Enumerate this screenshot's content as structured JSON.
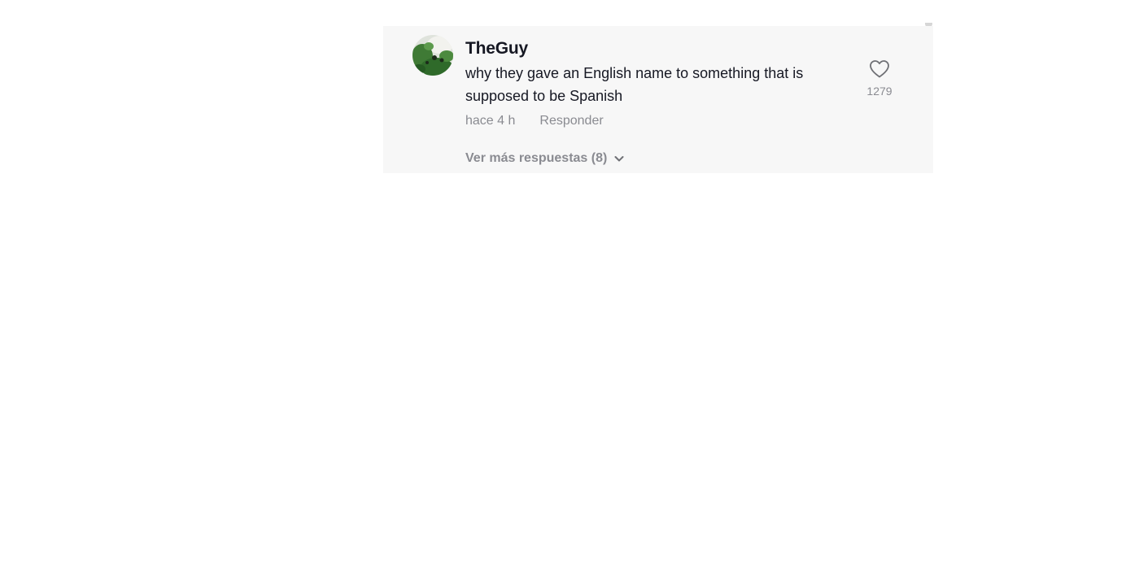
{
  "comment": {
    "username": "TheGuy",
    "text": "why they gave an English name to something that is supposed to be Spanish",
    "timestamp": "hace 4 h",
    "reply_label": "Responder",
    "like_count": "1279",
    "more_replies_label": "Ver más respuestas (8)",
    "avatar_icon": "avatar-photo",
    "like_icon": "heart-outline-icon",
    "expand_icon": "chevron-down-icon"
  },
  "colors": {
    "panel_background": "#f7f7f7",
    "primary_text": "#161823",
    "secondary_text": "#8a8b91"
  }
}
